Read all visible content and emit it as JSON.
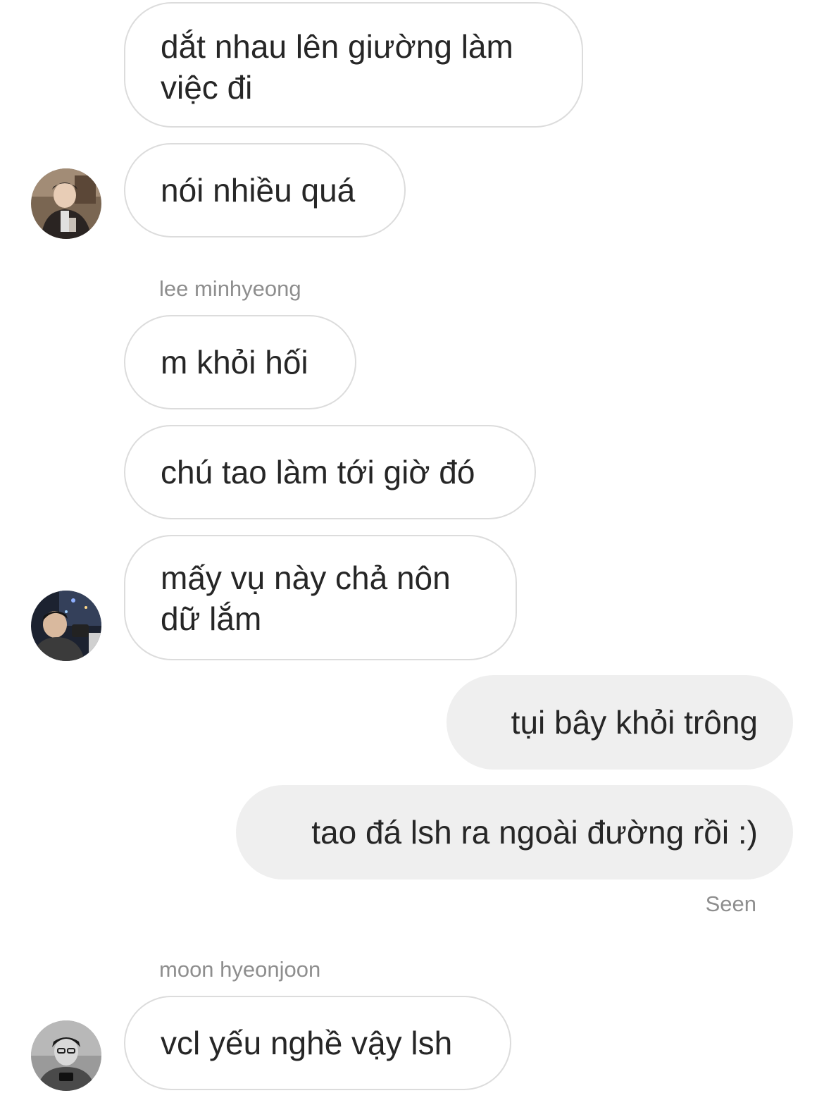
{
  "thread": {
    "messages": [
      {
        "id": "m1",
        "side": "incoming",
        "lines": [
          "dắt nhau lên giường làm",
          "việc đi"
        ]
      },
      {
        "id": "m2",
        "side": "incoming",
        "lines": [
          "nói nhiều quá"
        ]
      },
      {
        "id": "m3",
        "side": "incoming",
        "sender": "lee minhyeong",
        "lines": [
          "m khỏi hối"
        ]
      },
      {
        "id": "m4",
        "side": "incoming",
        "lines": [
          "chú tao làm tới giờ đó"
        ]
      },
      {
        "id": "m5",
        "side": "incoming",
        "lines": [
          "mấy vụ này chả nôn",
          "dữ lắm"
        ]
      },
      {
        "id": "m6",
        "side": "outgoing",
        "lines": [
          "tụi bây khỏi trông"
        ]
      },
      {
        "id": "m7",
        "side": "outgoing",
        "lines": [
          "tao đá lsh ra ngoài đường rồi :)"
        ]
      },
      {
        "id": "m8",
        "side": "incoming",
        "sender": "moon hyeonjoon",
        "lines": [
          "vcl yếu nghề vậy lsh"
        ]
      }
    ],
    "seen_label": "Seen"
  },
  "avatars": [
    {
      "name": "avatar-user-1",
      "icon": "profile-photo"
    },
    {
      "name": "avatar-lee-minhyeong",
      "icon": "profile-photo"
    },
    {
      "name": "avatar-moon-hyeonjoon",
      "icon": "profile-photo"
    }
  ],
  "colors": {
    "incoming_bubble_border": "#dcdcdc",
    "outgoing_bubble_bg": "#efefef",
    "text": "#262626",
    "meta_text": "#8e8e8e"
  }
}
